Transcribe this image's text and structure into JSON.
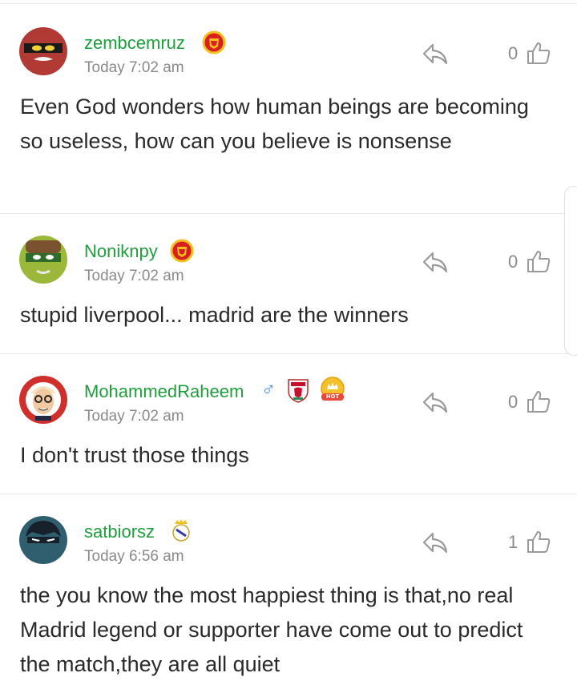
{
  "comments": [
    {
      "username": "zembcemruz",
      "timestamp": "Today 7:02 am",
      "text": "Even God wonders how human beings are becoming so useless, how can you believe is nonsense",
      "likes": "0",
      "badges": [
        "manchester-united-badge"
      ],
      "avatar": "red-masked-avatar"
    },
    {
      "username": "Noniknpy",
      "timestamp": "Today 7:02 am",
      "text": "stupid liverpool... madrid are the winners",
      "likes": "0",
      "badges": [
        "manchester-united-badge"
      ],
      "avatar": "green-masked-avatar"
    },
    {
      "username": "MohammedRaheem",
      "gender_symbol": "♂",
      "timestamp": "Today 7:02 am",
      "text": "I don't trust those things",
      "likes": "0",
      "badges": [
        "liverpool-badge",
        "hot-badge"
      ],
      "hot_label": "HOT",
      "avatar": "cartoon-man-avatar"
    },
    {
      "username": "satbiorsz",
      "timestamp": "Today 6:56 am",
      "text": "the you know the most happiest thing is that,no real Madrid legend or supporter have come out to predict the match,they are all quiet",
      "likes": "1",
      "badges": [
        "real-madrid-badge"
      ],
      "avatar": "teal-masked-avatar"
    }
  ],
  "colors": {
    "username": "#1e9e3c",
    "meta": "#8a8a8a",
    "text": "#2a2a2a",
    "divider": "#e8e8e8"
  }
}
